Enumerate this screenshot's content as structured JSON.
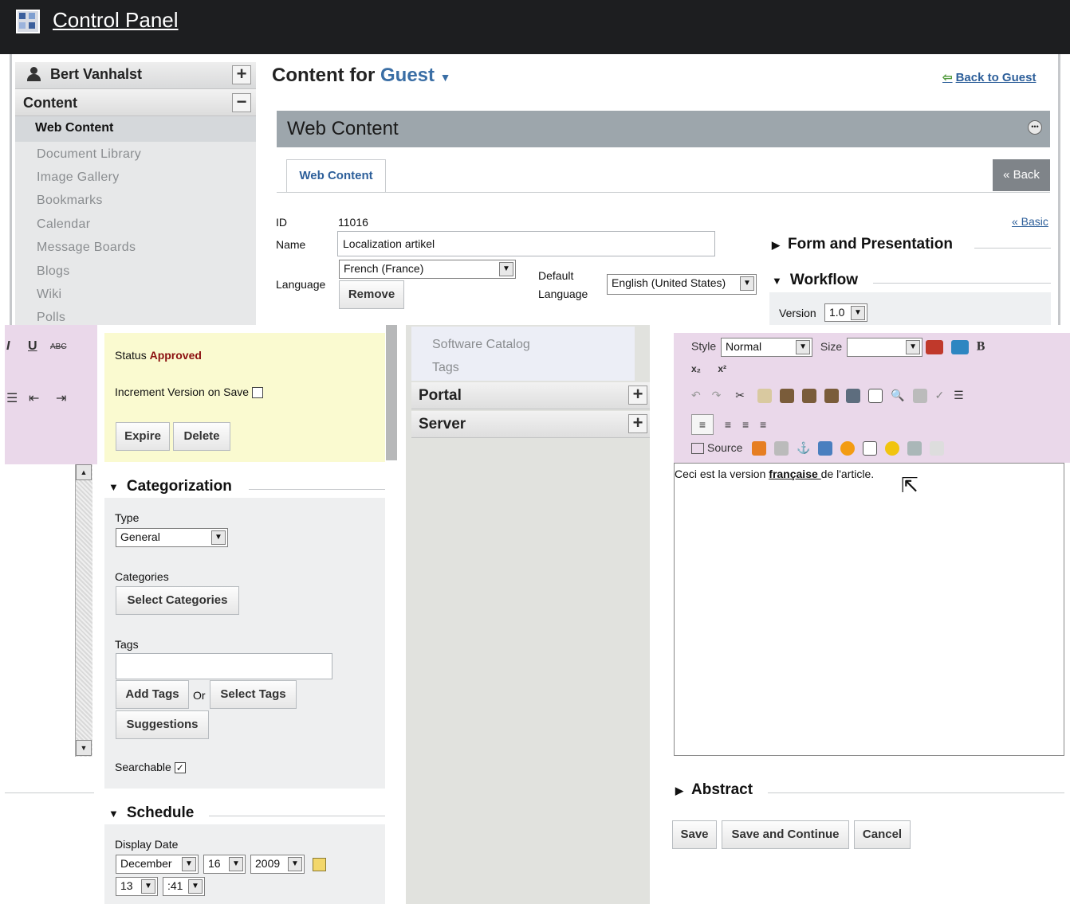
{
  "topbar": {
    "title": "Control Panel"
  },
  "sidebar": {
    "user": "Bert Vanhalst",
    "section": "Content",
    "active": "Web Content",
    "items": [
      "Document Library",
      "Image Gallery",
      "Bookmarks",
      "Calendar",
      "Message Boards",
      "Blogs",
      "Wiki",
      "Polls"
    ],
    "more_items": [
      "Software Catalog",
      "Tags"
    ],
    "portal": "Portal",
    "server": "Server"
  },
  "header": {
    "prefix": "Content for",
    "scope": "Guest",
    "back_link": "Back to Guest"
  },
  "panel": {
    "title": "Web Content",
    "tab": "Web Content",
    "back_button": "« Back",
    "basic_link": "« Basic"
  },
  "form": {
    "id_label": "ID",
    "id_value": "11016",
    "name_label": "Name",
    "name_value": "Localization artikel",
    "language_label": "Language",
    "language_value": "French (France)",
    "remove_button": "Remove",
    "default_language_label_1": "Default",
    "default_language_label_2": "Language",
    "default_language_value": "English (United States)"
  },
  "sections": {
    "form_presentation": "Form and Presentation",
    "workflow": "Workflow",
    "version_label": "Version",
    "version_value": "1.0",
    "categorization": "Categorization",
    "schedule": "Schedule",
    "abstract": "Abstract"
  },
  "workflow": {
    "status_label": "Status",
    "status_value": "Approved",
    "increment_label": "Increment Version on Save",
    "expire_button": "Expire",
    "delete_button": "Delete"
  },
  "categorization": {
    "type_label": "Type",
    "type_value": "General",
    "categories_label": "Categories",
    "select_categories": "Select Categories",
    "tags_label": "Tags",
    "add_tags": "Add Tags",
    "or": "Or",
    "select_tags": "Select Tags",
    "suggestions": "Suggestions",
    "searchable_label": "Searchable"
  },
  "schedule": {
    "display_date_label": "Display Date",
    "month": "December",
    "day": "16",
    "year": "2009",
    "hour": "13",
    "minute": ":41"
  },
  "editor": {
    "style_label": "Style",
    "style_value": "Normal",
    "size_label": "Size",
    "source_label": "Source",
    "text_before": "Ceci est la version ",
    "text_bold": "française ",
    "text_after": "de l'article.",
    "left_glyphs": [
      "I",
      "U",
      "ABC"
    ]
  },
  "actions": {
    "save": "Save",
    "save_continue": "Save and Continue",
    "cancel": "Cancel"
  }
}
